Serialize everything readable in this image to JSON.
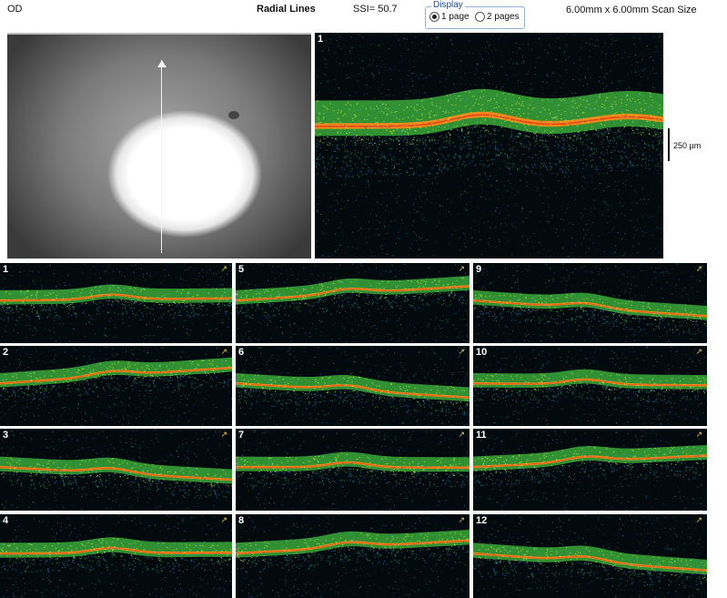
{
  "header": {
    "eye": "OD",
    "scan_type": "Radial Lines",
    "ssi": "SSI= 50.7",
    "scan_size": "6.00mm x 6.00mm Scan Size"
  },
  "display": {
    "legend": "Display",
    "option_1": "1 page",
    "option_2": "2 pages",
    "selected": "1 page"
  },
  "main_scan": {
    "label": "1",
    "scale_label": "250 µm"
  },
  "thumbnails": [
    {
      "label": "1"
    },
    {
      "label": "2"
    },
    {
      "label": "3"
    },
    {
      "label": "4"
    },
    {
      "label": "5"
    },
    {
      "label": "6"
    },
    {
      "label": "7"
    },
    {
      "label": "8"
    },
    {
      "label": "9"
    },
    {
      "label": "10"
    },
    {
      "label": "11"
    },
    {
      "label": "12"
    }
  ],
  "colors": {
    "retina_green": "#4fbf3a",
    "rpe_orange": "#f07a1a",
    "noise_blue": "#2a7fb0",
    "background": "#030a0e"
  }
}
